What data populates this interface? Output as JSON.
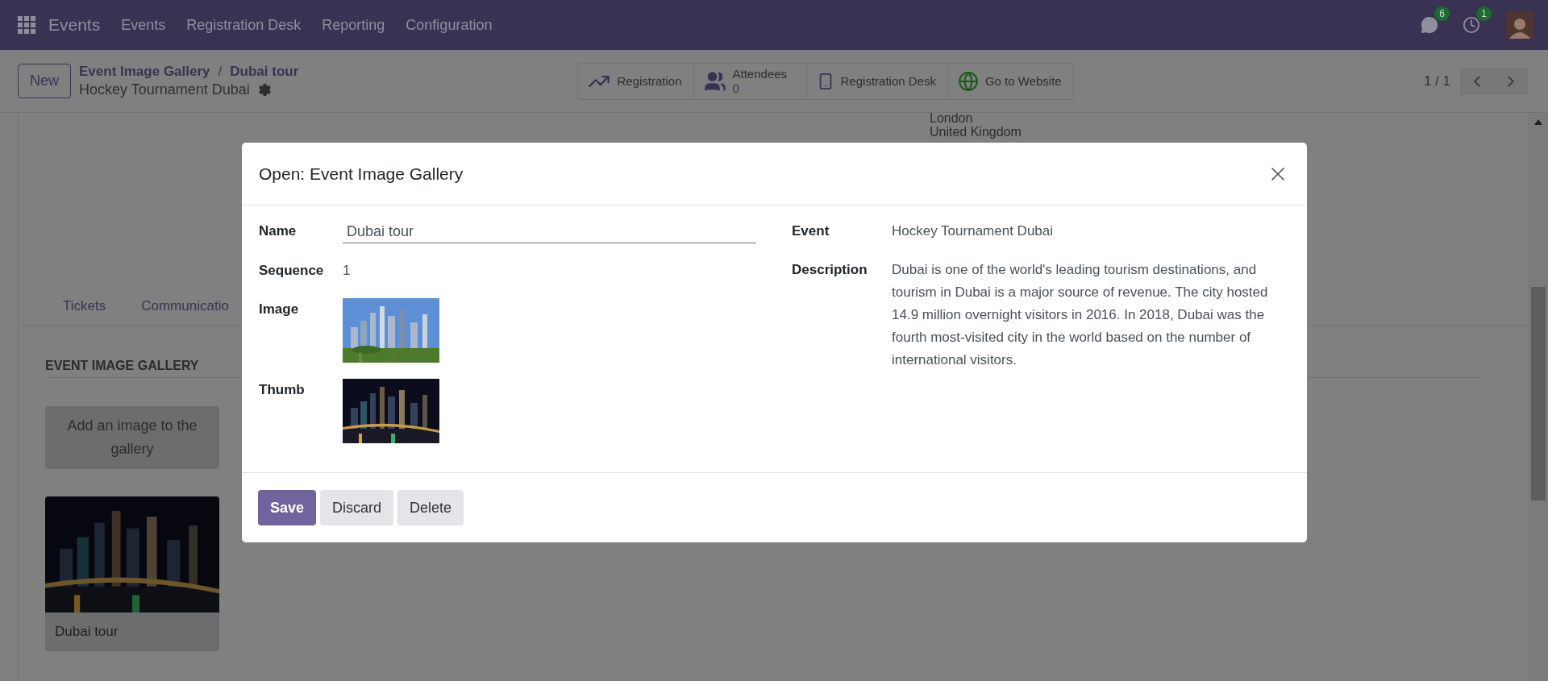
{
  "navbar": {
    "app": "Events",
    "menus": [
      "Events",
      "Registration Desk",
      "Reporting",
      "Configuration"
    ],
    "messages_badge": "6",
    "activities_badge": "1"
  },
  "control_panel": {
    "new_button": "New",
    "breadcrumb": [
      "Event Image Gallery",
      "Dubai tour"
    ],
    "breadcrumb_separator": "/",
    "record": "Hockey Tournament Dubai",
    "stat_buttons": [
      {
        "kind": "chart",
        "label": "Registration"
      },
      {
        "kind": "people",
        "label": "Attendees",
        "value": "0"
      },
      {
        "kind": "phone",
        "label": "Registration Desk"
      },
      {
        "kind": "globe",
        "label": "Go to Website"
      }
    ],
    "pager": "1 / 1"
  },
  "sheet": {
    "address": [
      "London",
      "United Kingdom"
    ],
    "tabs": [
      {
        "label": "Tickets",
        "selected": false
      },
      {
        "label": "Communicatio",
        "selected": false
      }
    ],
    "section_title": "EVENT IMAGE GALLERY",
    "add_button": "Add an image to the gallery",
    "cards": [
      {
        "name": "Dubai tour"
      }
    ]
  },
  "dialog": {
    "title": "Open: Event Image Gallery",
    "left_fields": [
      {
        "kind": "input",
        "label": "Name",
        "value": "Dubai tour"
      },
      {
        "kind": "text",
        "label": "Sequence",
        "value": "1"
      },
      {
        "label": "Image"
      },
      {
        "label": "Thumb"
      }
    ],
    "right_fields": [
      {
        "kind": "text",
        "label": "Event",
        "value": "Hockey Tournament Dubai"
      },
      {
        "kind": "text",
        "label": "Description",
        "value": "Dubai is one of the world's leading tourism destinations, and tourism in Dubai is a major source of revenue. The city hosted 14.9 million overnight visitors in 2016. In 2018, Dubai was the fourth most-visited city in the world based on the number of international visitors."
      }
    ],
    "buttons": [
      {
        "label": "Save",
        "kind": "primary"
      },
      {
        "label": "Discard",
        "kind": "secondary"
      },
      {
        "label": "Delete",
        "kind": "secondary"
      }
    ]
  }
}
